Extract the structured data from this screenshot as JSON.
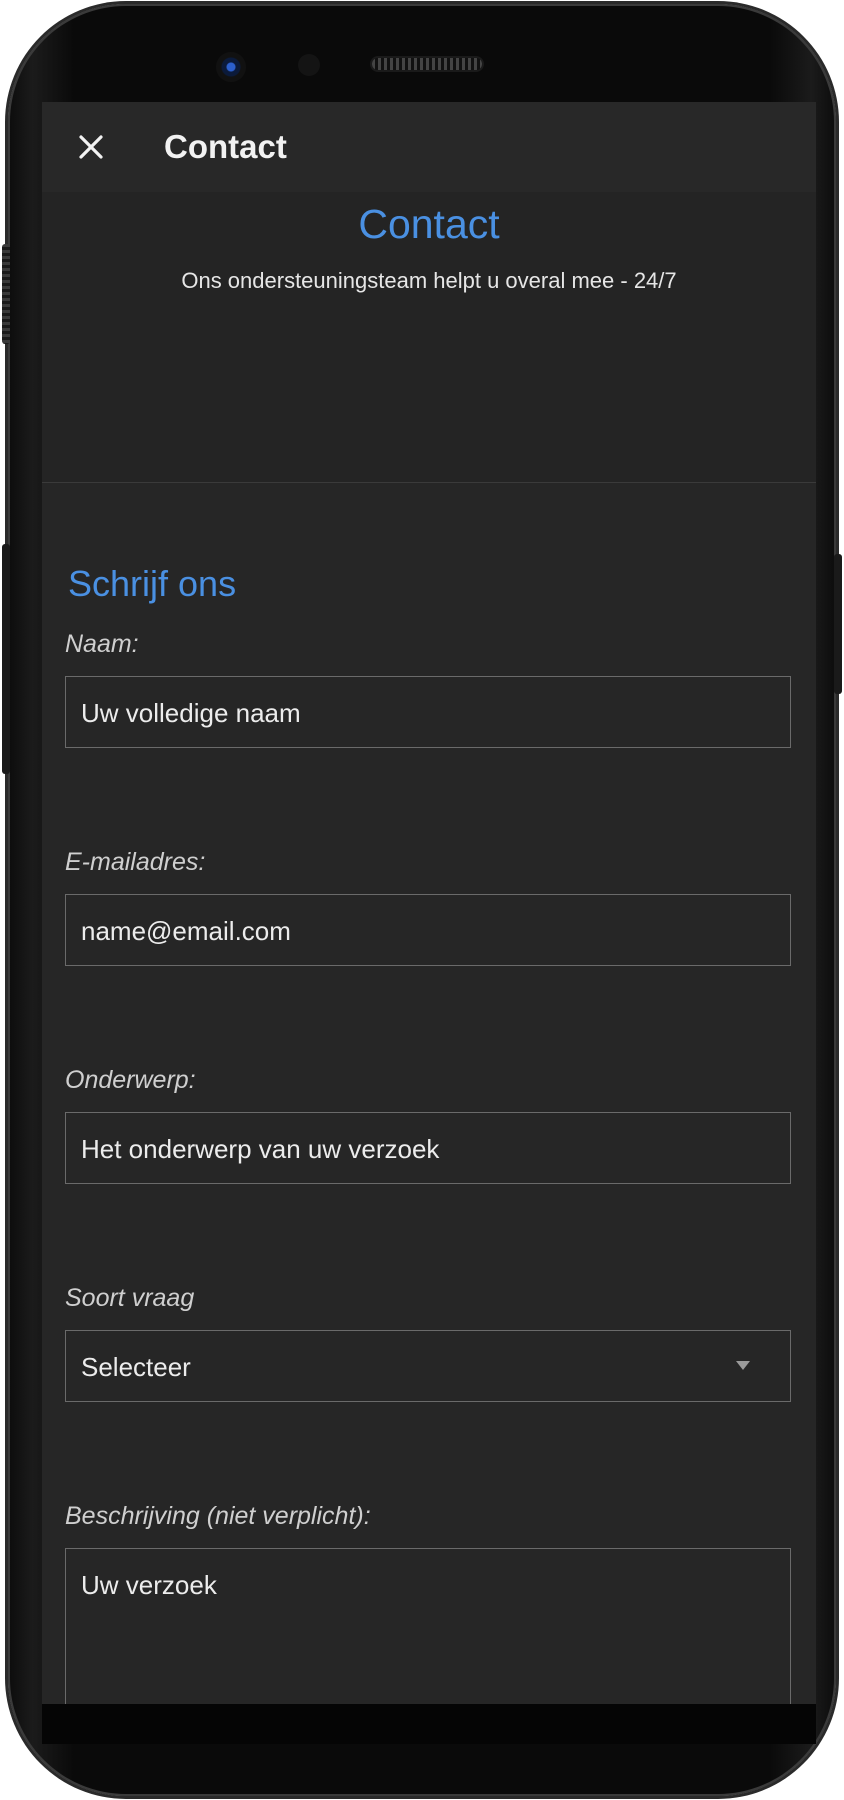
{
  "topbar": {
    "close_icon": "close-icon",
    "title": "Contact"
  },
  "hero": {
    "title": "Contact",
    "subtitle": "Ons ondersteuningsteam helpt u overal mee - 24/7"
  },
  "form": {
    "section_title": "Schrijf ons",
    "name": {
      "label": "Naam:",
      "placeholder": "Uw volledige naam"
    },
    "email": {
      "label": "E-mailadres:",
      "placeholder": "name@email.com"
    },
    "subject": {
      "label": "Onderwerp:",
      "placeholder": "Het onderwerp van uw verzoek"
    },
    "question_type": {
      "label": "Soort vraag",
      "selected": "Selecteer",
      "icon": "dropdown-arrow-icon"
    },
    "description": {
      "label": "Beschrijving (niet verplicht):",
      "placeholder": "Uw verzoek"
    }
  },
  "colors": {
    "accent": "#4a90e2",
    "screen_background": "#262626",
    "text": "#ececec",
    "border": "#6a6a6a"
  }
}
